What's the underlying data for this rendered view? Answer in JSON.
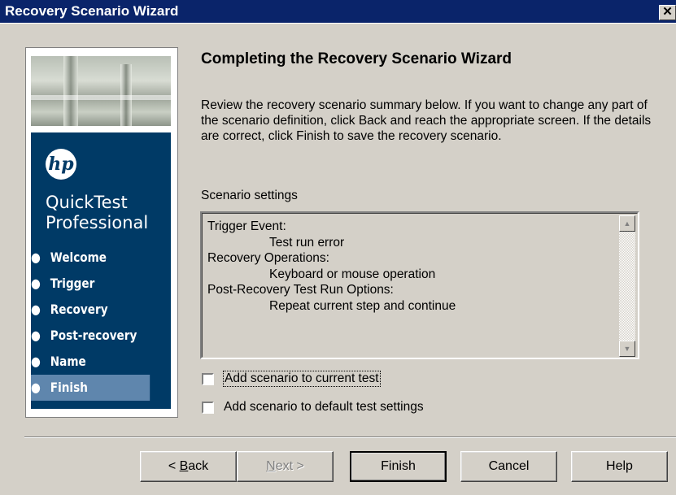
{
  "window": {
    "title": "Recovery Scenario Wizard",
    "close_glyph": "✕"
  },
  "sidebar": {
    "logo_text": "hp",
    "product_line1": "QuickTest",
    "product_line2": "Professional",
    "bullet": "●",
    "steps": [
      {
        "label": "Welcome"
      },
      {
        "label": "Trigger"
      },
      {
        "label": "Recovery"
      },
      {
        "label": "Post-recovery"
      },
      {
        "label": "Name"
      },
      {
        "label": "Finish",
        "active": true
      }
    ]
  },
  "main": {
    "heading": "Completing the Recovery Scenario Wizard",
    "intro": "Review the recovery scenario summary below. If you want to change any part of the scenario definition, click Back and reach the appropriate screen. If the details are correct, click Finish to save the recovery scenario.",
    "settings_label": "Scenario settings",
    "summary": [
      {
        "text": "Trigger Event:"
      },
      {
        "text": "Test run error"
      },
      {
        "text": "Recovery Operations:"
      },
      {
        "text": "Keyboard or mouse operation"
      },
      {
        "text": "Post-Recovery Test Run Options:"
      },
      {
        "text": "Repeat current step and continue"
      }
    ],
    "scroll_up_glyph": "▲",
    "scroll_down_glyph": "▼",
    "checkbox_current": {
      "label": "Add scenario to current test",
      "checked": false
    },
    "checkbox_default": {
      "label": "Add scenario to default test settings",
      "checked": false
    }
  },
  "buttons": {
    "back_prefix": "< ",
    "back_mnemonic": "B",
    "back_rest": "ack",
    "next_mnemonic": "N",
    "next_rest": "ext >",
    "finish": "Finish",
    "cancel": "Cancel",
    "help": "Help"
  },
  "colors": {
    "titlebar": "#0a246a",
    "nav_panel": "#003a66",
    "nav_active": "#5f86ad",
    "dialog_bg": "#d4d0c8"
  }
}
